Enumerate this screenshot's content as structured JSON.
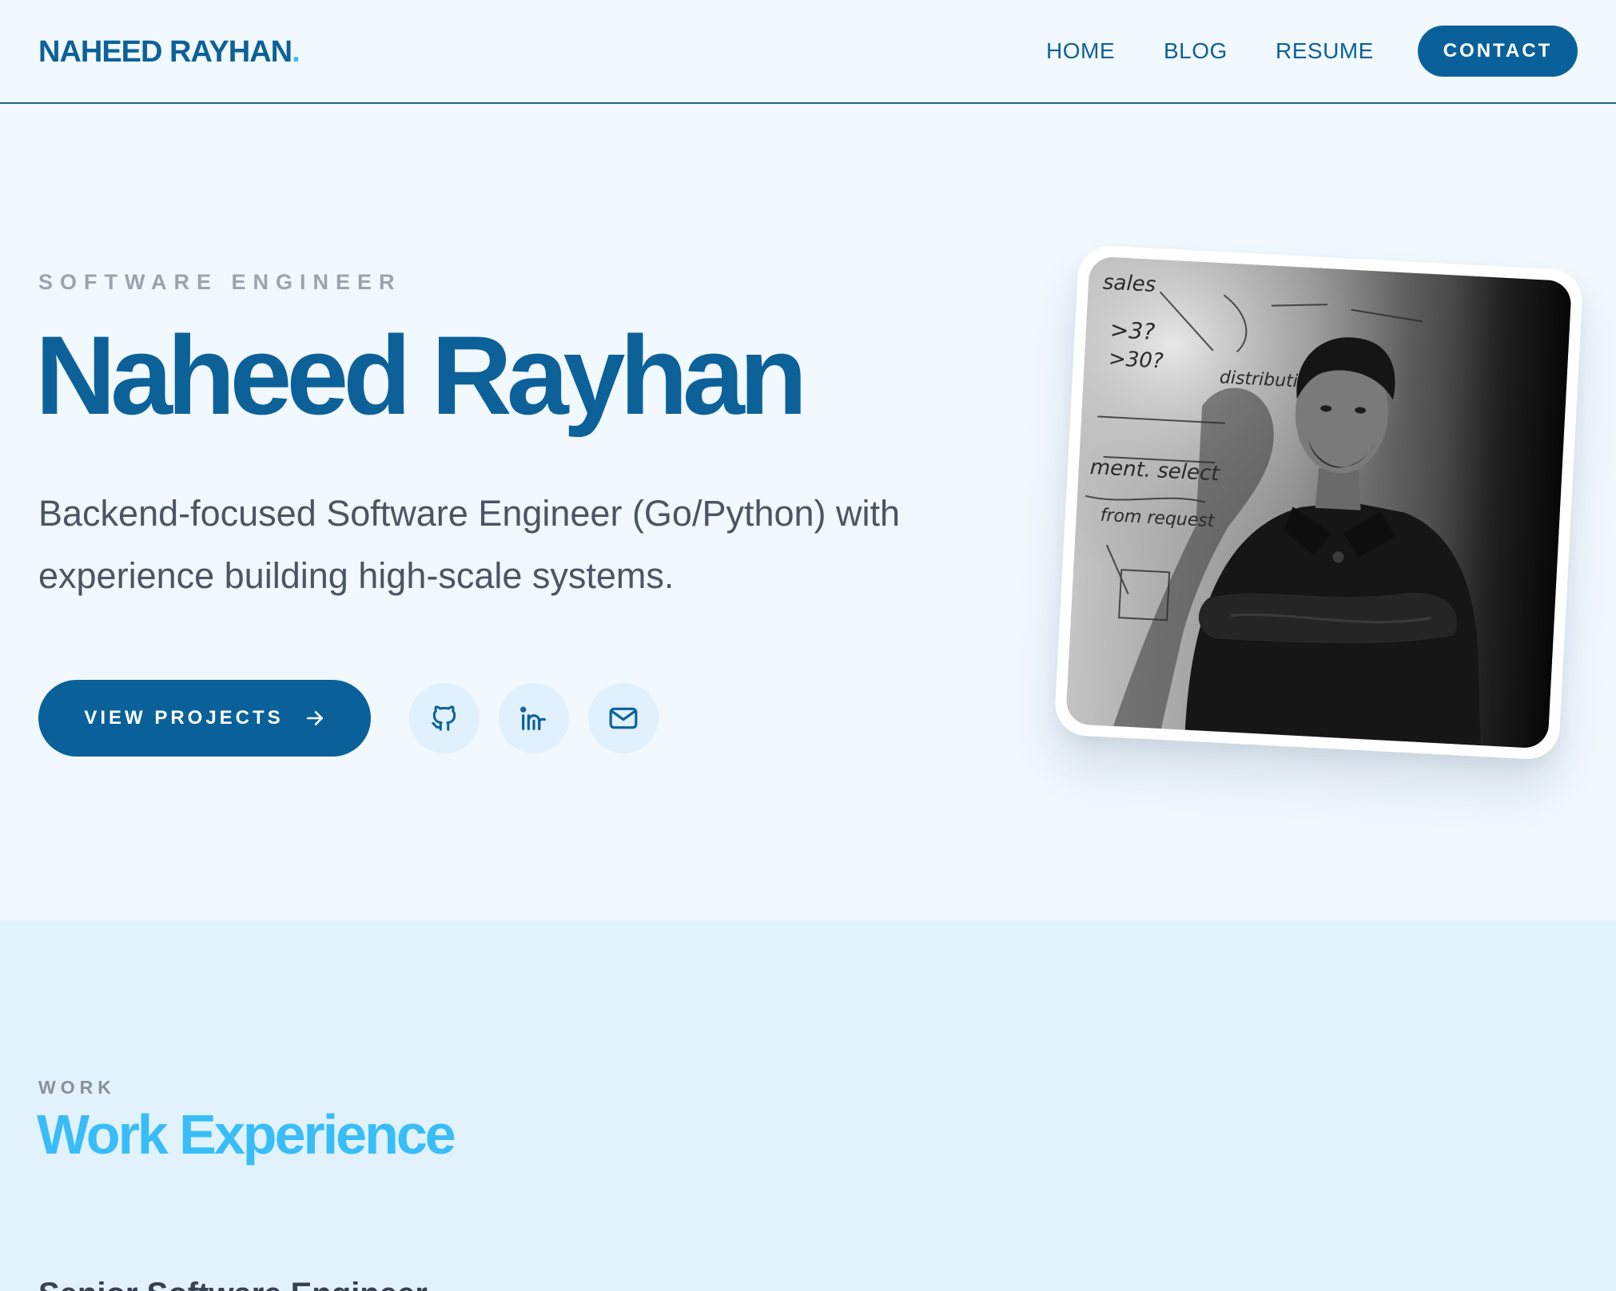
{
  "nav": {
    "brand": "NAHEED RAYHAN",
    "brand_dot": ".",
    "links": [
      {
        "label": "HOME"
      },
      {
        "label": "BLOG"
      },
      {
        "label": "RESUME"
      }
    ],
    "contact_label": "CONTACT"
  },
  "hero": {
    "eyebrow": "SOFTWARE ENGINEER",
    "title": "Naheed Rayhan",
    "subtitle": "Backend-focused Software Engineer (Go/Python) with experience building high-scale systems.",
    "cta_label": "VIEW PROJECTS",
    "social": [
      {
        "icon": "github-icon"
      },
      {
        "icon": "linkedin-icon"
      },
      {
        "icon": "mail-icon"
      }
    ],
    "photo_whiteboard_text": [
      "sales",
      ">3?",
      ">30?",
      "distribution",
      "ment. select",
      "from request"
    ]
  },
  "work": {
    "eyebrow": "WORK",
    "title": "Work Experience",
    "first_job_title": "Senior Software Engineer"
  },
  "colors": {
    "primary": "#0a6199",
    "accent": "#38bdf8",
    "background": "#f1f8fe",
    "section_background": "#e1f2fd",
    "muted": "#9ca3af",
    "body_text": "#4b5563"
  }
}
